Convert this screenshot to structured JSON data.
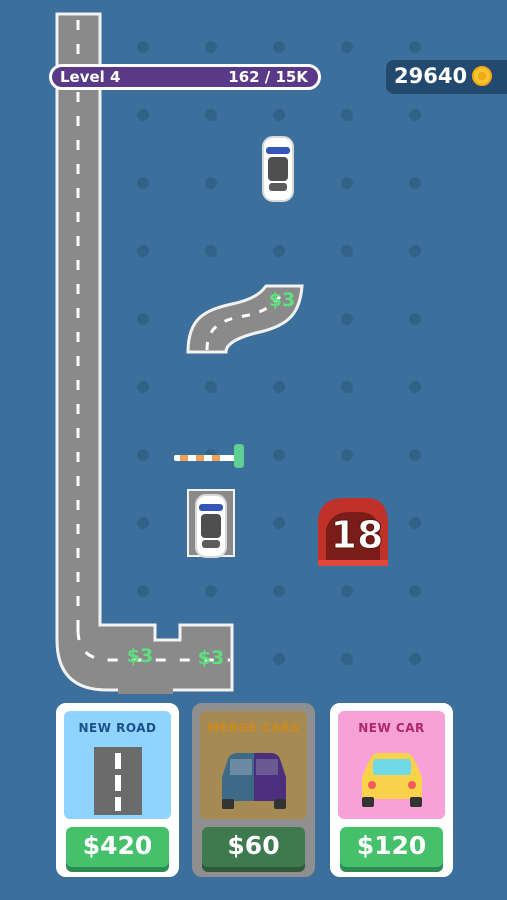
{
  "hud": {
    "level_label": "Level 4",
    "progress_text": "162 / 15K",
    "coins": "29640"
  },
  "board": {
    "road_rewards": [
      "$3",
      "$3",
      "$3"
    ],
    "counter_badge": "18"
  },
  "shop": {
    "new_road": {
      "title": "NEW ROAD",
      "price": "$420"
    },
    "merge_cars": {
      "title": "MERGE CARS",
      "price": "$60"
    },
    "new_car": {
      "title": "NEW CAR",
      "price": "$120"
    }
  },
  "colors": {
    "background": "#3c6f9c",
    "road": "#8a8a8a",
    "level_bar": "#5a3a88",
    "price_green": "#45c06b",
    "badge_red": "#c0312a"
  }
}
